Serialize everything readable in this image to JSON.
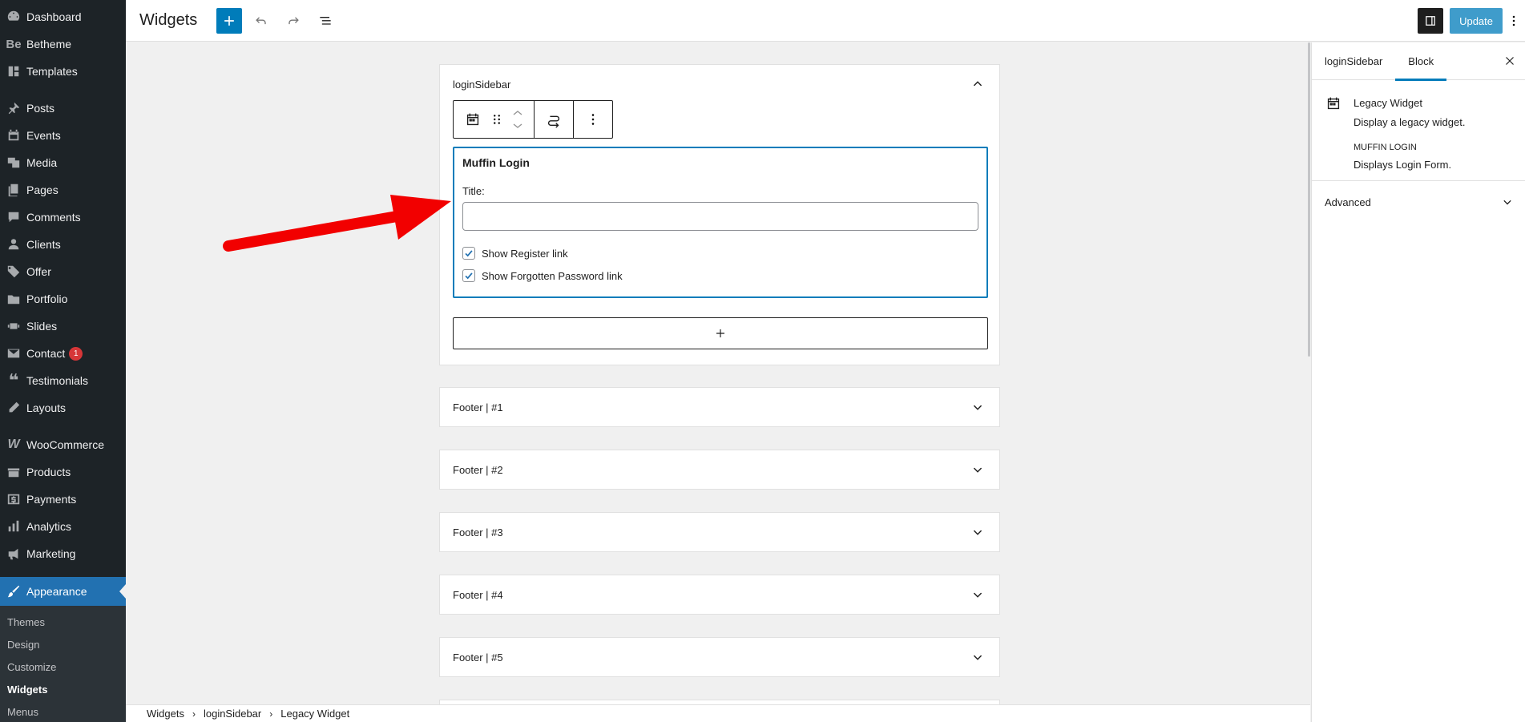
{
  "admin_menu": {
    "items": [
      {
        "label": "Dashboard",
        "icon": "dashboard-icon"
      },
      {
        "label": "Betheme",
        "icon": "betheme-icon"
      },
      {
        "label": "Templates",
        "icon": "templates-icon"
      },
      {
        "label": "Posts",
        "icon": "pin-icon"
      },
      {
        "label": "Events",
        "icon": "events-icon"
      },
      {
        "label": "Media",
        "icon": "media-icon"
      },
      {
        "label": "Pages",
        "icon": "pages-icon"
      },
      {
        "label": "Comments",
        "icon": "comments-icon"
      },
      {
        "label": "Clients",
        "icon": "clients-icon"
      },
      {
        "label": "Offer",
        "icon": "tag-icon"
      },
      {
        "label": "Portfolio",
        "icon": "portfolio-icon"
      },
      {
        "label": "Slides",
        "icon": "slides-icon"
      },
      {
        "label": "Contact",
        "icon": "mail-icon",
        "badge": "1"
      },
      {
        "label": "Testimonials",
        "icon": "quote-icon"
      },
      {
        "label": "Layouts",
        "icon": "layouts-icon"
      },
      {
        "label": "WooCommerce",
        "icon": "woocommerce-icon"
      },
      {
        "label": "Products",
        "icon": "products-icon"
      },
      {
        "label": "Payments",
        "icon": "payments-icon"
      },
      {
        "label": "Analytics",
        "icon": "analytics-icon"
      },
      {
        "label": "Marketing",
        "icon": "megaphone-icon"
      },
      {
        "label": "Appearance",
        "icon": "brush-icon"
      }
    ],
    "submenu": [
      "Themes",
      "Design",
      "Customize",
      "Widgets",
      "Menus"
    ],
    "active_sub": "Widgets"
  },
  "header": {
    "title": "Widgets",
    "update_label": "Update"
  },
  "canvas": {
    "open_area": {
      "title": "loginSidebar",
      "widget": {
        "title": "Muffin Login",
        "field_label": "Title:",
        "field_value": "",
        "checkboxes": [
          {
            "label": "Show Register link",
            "checked": true
          },
          {
            "label": "Show Forgotten Password link",
            "checked": true
          }
        ]
      }
    },
    "closed_areas": [
      "Footer | #1",
      "Footer | #2",
      "Footer | #3",
      "Footer | #4",
      "Footer | #5"
    ]
  },
  "breadcrumb": [
    "Widgets",
    "loginSidebar",
    "Legacy Widget"
  ],
  "settings": {
    "tabs": [
      "loginSidebar",
      "Block"
    ],
    "active_tab": "Block",
    "block": {
      "title": "Legacy Widget",
      "description": "Display a legacy widget.",
      "widget_name": "MUFFIN LOGIN",
      "widget_description": "Displays Login Form."
    },
    "advanced_label": "Advanced"
  },
  "colors": {
    "admin_bg": "#1d2327",
    "accent": "#007cba",
    "wp_blue": "#2271b1",
    "badge": "#d63638",
    "arrow": "#f20000"
  }
}
